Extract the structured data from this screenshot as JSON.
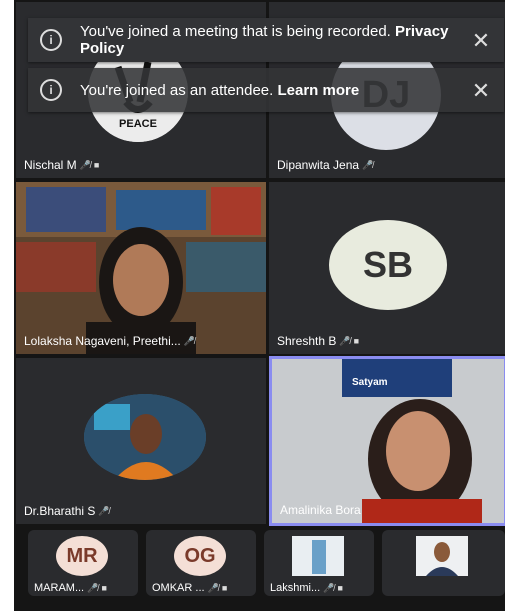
{
  "notifications": [
    {
      "text": "You've joined a meeting that is being recorded. ",
      "link": "Privacy Policy",
      "close": "✕"
    },
    {
      "text": "You're joined as an attendee. ",
      "link": "Learn more",
      "close": "✕"
    }
  ],
  "tiles": {
    "nischal": {
      "name": "Nischal M",
      "avatar_text": "PEACE"
    },
    "dipanwita": {
      "name": "Dipanwita Jena",
      "initials": "DJ"
    },
    "lolaksha": {
      "name": "Lolaksha Nagaveni, Preethi..."
    },
    "shreshth": {
      "name": "Shreshth B",
      "initials": "SB"
    },
    "bharathi": {
      "name": "Dr.Bharathi S"
    },
    "amalinika": {
      "name": "Amalinika Bora",
      "sign_text": "Satyam"
    }
  },
  "strip": [
    {
      "label": "MARAM...",
      "initials": "MR"
    },
    {
      "label": "OMKAR ...",
      "initials": "OG"
    },
    {
      "label": "Lakshmi...",
      "initials": ""
    },
    {
      "label": "",
      "initials": ""
    }
  ],
  "icons": {
    "mic_off": "mic-off-icon",
    "cam_off": "camera-off-icon",
    "info": "info-icon",
    "close": "close-icon"
  },
  "colors": {
    "background": "#151515",
    "tile": "#2a2b2e",
    "active_border": "#8a8cf0",
    "avatar_bg": "#e8ebde"
  }
}
